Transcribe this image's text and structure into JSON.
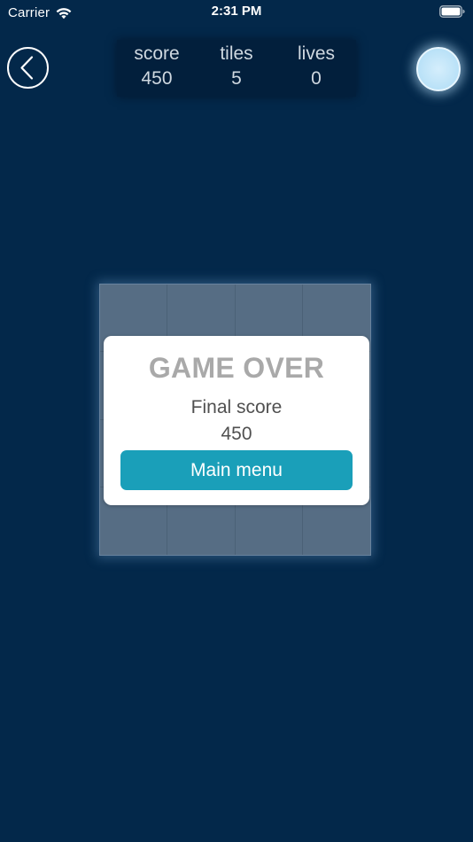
{
  "status_bar": {
    "carrier": "Carrier",
    "time": "2:31 PM"
  },
  "stats": {
    "score_label": "score",
    "score_value": "450",
    "tiles_label": "tiles",
    "tiles_value": "5",
    "lives_label": "lives",
    "lives_value": "0"
  },
  "icons": {
    "back": "chevron-left-icon",
    "hint": "glowing-orb-icon",
    "wifi": "wifi-icon",
    "battery": "battery-icon"
  },
  "board": {
    "rows": 4,
    "columns": 4
  },
  "dialog": {
    "title": "GAME OVER",
    "final_score_label": "Final score",
    "final_score_value": "450",
    "menu_button_label": "Main menu"
  },
  "colors": {
    "background": "#03284a",
    "board": "#566d84",
    "button": "#1a9fb9",
    "title_gray": "#a9a9a9"
  }
}
